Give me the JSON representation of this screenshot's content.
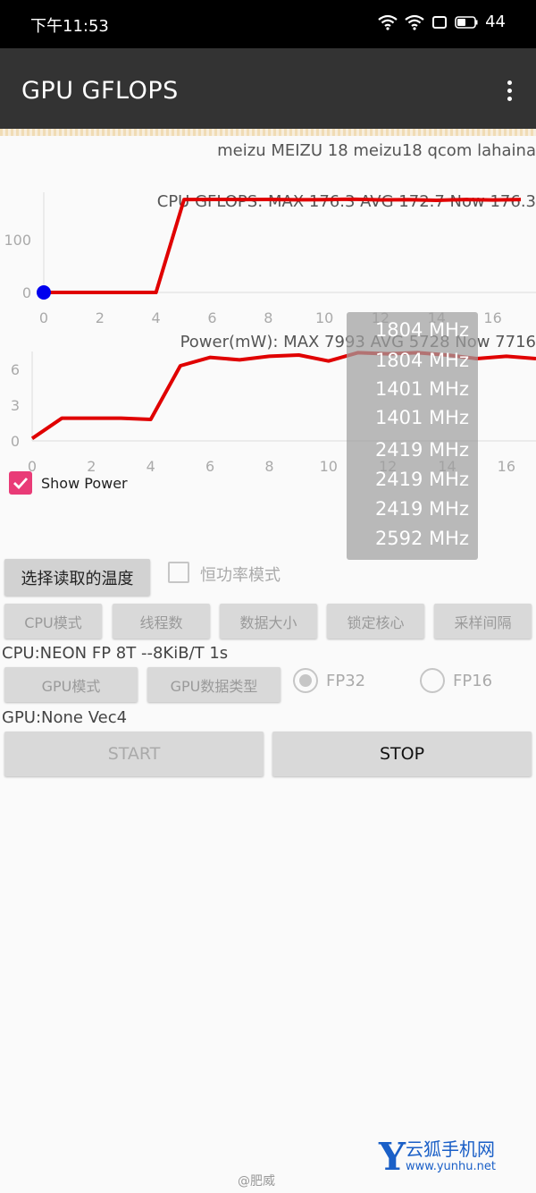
{
  "status_bar": {
    "time": "下午11:53",
    "battery": "44"
  },
  "app_bar": {
    "title": "GPU GFLOPS"
  },
  "device_info": "meizu MEIZU 18 meizu18 qcom lahaina",
  "cpu_chart": {
    "title": "CPU GFLOPS: MAX 176.3 AVG 172.7 Now 176.3",
    "x_ticks": [
      "0",
      "2",
      "4",
      "6",
      "8",
      "10",
      "12",
      "14",
      "16"
    ],
    "y_ticks": [
      "100",
      "0"
    ]
  },
  "power_chart": {
    "title": "Power(mW): MAX 7993 AVG 5728 Now 7716",
    "x_ticks": [
      "0",
      "2",
      "4",
      "6",
      "8",
      "10",
      "12",
      "14",
      "16"
    ],
    "y_ticks": [
      "6",
      "3",
      "0"
    ]
  },
  "chart_data": [
    {
      "type": "line",
      "title": "CPU GFLOPS: MAX 176.3 AVG 172.7 Now 176.3",
      "xlim": [
        0,
        17
      ],
      "ylim": [
        0,
        190
      ],
      "series": [
        {
          "color": "#e00000",
          "x": [
            0,
            4,
            5,
            6,
            7,
            8,
            9,
            10,
            11,
            12,
            13,
            14,
            15,
            16,
            17
          ],
          "y": [
            0,
            0,
            176.3,
            176.5,
            176.2,
            176.4,
            175.8,
            176.1,
            176.9,
            175.5,
            176.0,
            174.8,
            176.2,
            175.4,
            176.3
          ]
        }
      ],
      "start_marker": {
        "x": 0,
        "y": 0,
        "color": "#0000ee"
      }
    },
    {
      "type": "line",
      "title": "Power(mW): MAX 7993 AVG 5728 Now 7716",
      "xlim": [
        0,
        17
      ],
      "ylim": [
        0,
        7.5
      ],
      "series": [
        {
          "color": "#e00000",
          "x": [
            0,
            1,
            2,
            3,
            4,
            5,
            6,
            7,
            8,
            9,
            10,
            11,
            12,
            13,
            14,
            15,
            16,
            17
          ],
          "y": [
            0.2,
            1.9,
            1.9,
            1.9,
            1.8,
            6.3,
            7.0,
            6.8,
            7.1,
            7.2,
            6.7,
            7.4,
            7.3,
            7.4,
            7.2,
            6.9,
            7.1,
            6.9
          ]
        }
      ]
    }
  ],
  "freq_overlay": [
    "1804 MHz",
    "1804 MHz",
    "1401 MHz",
    "1401 MHz",
    "2419 MHz",
    "2419 MHz",
    "2419 MHz",
    "2592 MHz"
  ],
  "show_power": {
    "label": "Show Power"
  },
  "controls": {
    "temp_button": "选择读取的温度",
    "const_power": "恒功率模式",
    "row1": [
      "CPU模式",
      "线程数",
      "数据大小",
      "锁定核心",
      "采样间隔"
    ],
    "cpu_info": "CPU:NEON FP 8T --8KiB/T 1s",
    "gpu_mode": "GPU模式",
    "gpu_type": "GPU数据类型",
    "fp32": "FP32",
    "fp16": "FP16",
    "gpu_info": "GPU:None Vec4",
    "start": "START",
    "stop": "STOP"
  },
  "watermark": "@肥威",
  "brand": {
    "letter": "Y",
    "name": "云狐手机网",
    "url": "www.yunhu.net"
  },
  "colors": {
    "line": "#e00000",
    "marker": "#0000ee",
    "checkbox": "#e93b77",
    "app_bar": "#333333"
  }
}
